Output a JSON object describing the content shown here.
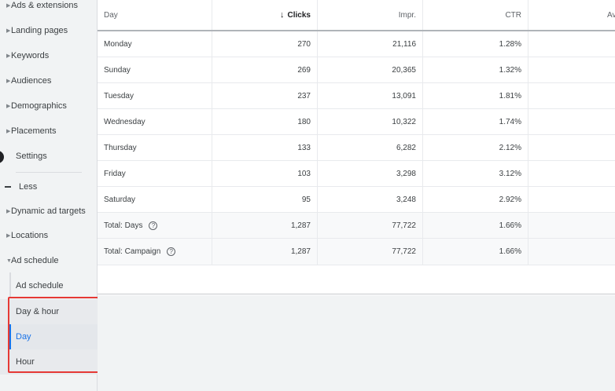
{
  "sidebar": {
    "items": [
      {
        "label": "Ads & extensions"
      },
      {
        "label": "Landing pages"
      },
      {
        "label": "Keywords"
      },
      {
        "label": "Audiences"
      },
      {
        "label": "Demographics"
      },
      {
        "label": "Placements"
      },
      {
        "label": "Settings"
      },
      {
        "label": "Less"
      },
      {
        "label": "Dynamic ad targets"
      },
      {
        "label": "Locations"
      },
      {
        "label": "Ad schedule"
      }
    ],
    "subitems": [
      {
        "label": "Ad schedule"
      },
      {
        "label": "Day & hour"
      },
      {
        "label": "Day"
      },
      {
        "label": "Hour"
      }
    ]
  },
  "table": {
    "headers": {
      "day": "Day",
      "clicks": "Clicks",
      "impr": "Impr.",
      "ctr": "CTR",
      "avg": "Avg"
    },
    "rows": [
      {
        "day": "Monday",
        "clicks": "270",
        "impr": "21,116",
        "ctr": "1.28%"
      },
      {
        "day": "Sunday",
        "clicks": "269",
        "impr": "20,365",
        "ctr": "1.32%"
      },
      {
        "day": "Tuesday",
        "clicks": "237",
        "impr": "13,091",
        "ctr": "1.81%"
      },
      {
        "day": "Wednesday",
        "clicks": "180",
        "impr": "10,322",
        "ctr": "1.74%"
      },
      {
        "day": "Thursday",
        "clicks": "133",
        "impr": "6,282",
        "ctr": "2.12%"
      },
      {
        "day": "Friday",
        "clicks": "103",
        "impr": "3,298",
        "ctr": "3.12%"
      },
      {
        "day": "Saturday",
        "clicks": "95",
        "impr": "3,248",
        "ctr": "2.92%"
      }
    ],
    "totals": [
      {
        "label": "Total: Days",
        "clicks": "1,287",
        "impr": "77,722",
        "ctr": "1.66%"
      },
      {
        "label": "Total: Campaign",
        "clicks": "1,287",
        "impr": "77,722",
        "ctr": "1.66%"
      }
    ]
  },
  "colors": {
    "accent": "#1a73e8",
    "highlight": "#e53935"
  }
}
